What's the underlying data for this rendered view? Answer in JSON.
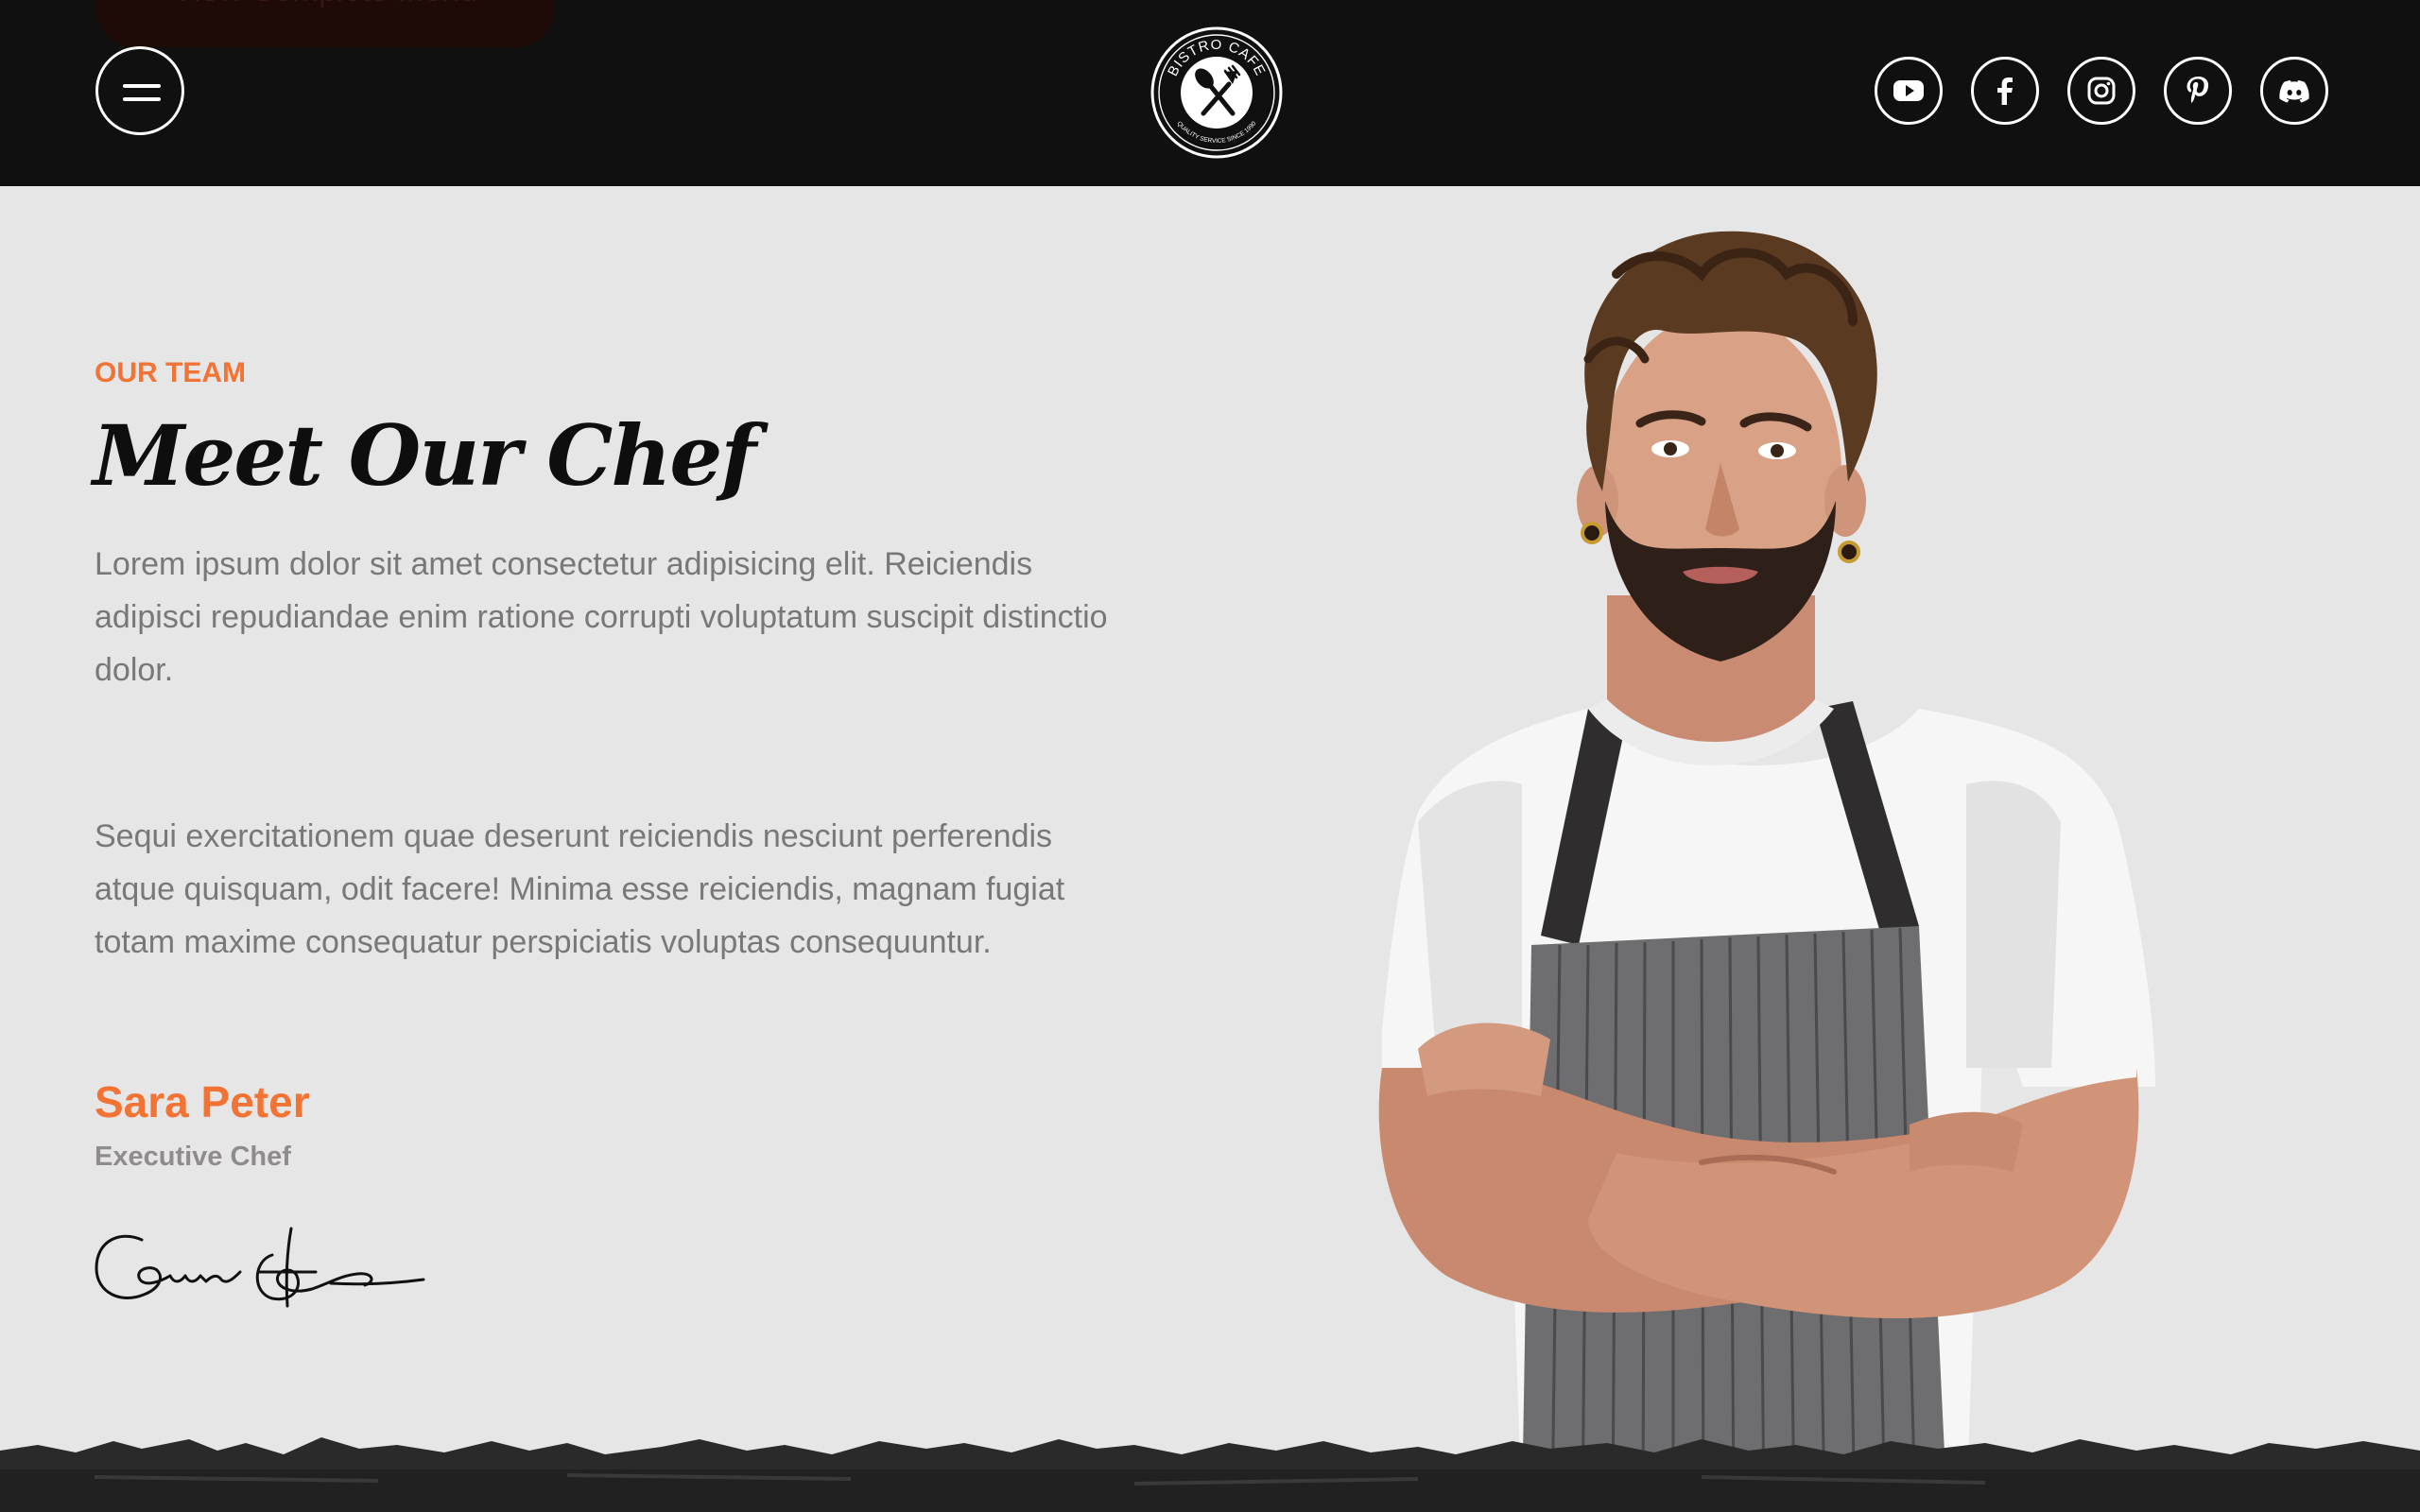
{
  "header": {
    "ghost_button_label": "View Complete Menu",
    "logo": {
      "top_text": "BISTRO CAFE",
      "bottom_text": "QUALITY SERVICE SINCE 1990"
    },
    "socials": [
      {
        "icon": "youtube-icon"
      },
      {
        "icon": "facebook-icon"
      },
      {
        "icon": "instagram-icon"
      },
      {
        "icon": "pinterest-icon"
      },
      {
        "icon": "discord-icon"
      }
    ]
  },
  "team": {
    "eyebrow": "OUR TEAM",
    "title": "Meet Our Chef",
    "paragraph_1": "Lorem ipsum dolor sit amet consectetur adipisicing elit. Reiciendis adipisci repudiandae enim ratione corrupti voluptatum suscipit distinctio dolor.",
    "paragraph_2": "Sequi exercitationem quae deserunt reiciendis nesciunt perferendis atque quisquam, odit facere! Minima esse reiciendis, magnam fugiat totam maxime consequatur perspiciatis voluptas consequuntur.",
    "chef_name": "Sara Peter",
    "chef_role": "Executive Chef"
  },
  "colors": {
    "accent": "#f37335",
    "header_bg": "#101010",
    "page_bg": "#e7e6e6",
    "body_text": "#7a7877"
  }
}
